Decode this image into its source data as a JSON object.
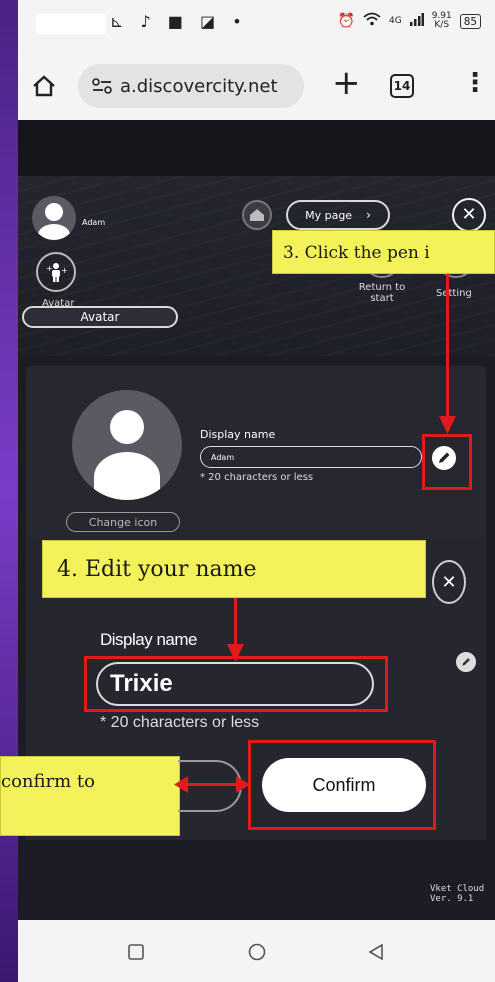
{
  "status_bar": {
    "left_icons": "⊾ ♪ ■ ◪ •",
    "network": "4G",
    "speed_value": "9.91",
    "speed_unit": "K/S",
    "battery": "85"
  },
  "browser": {
    "url": "a.discovercity.net",
    "tab_count": "14"
  },
  "hud": {
    "username": "Adam",
    "avatar_label": "Avatar",
    "mypage_label": "My page",
    "return_label_line1": "Return to",
    "return_label_line2": "start",
    "setting_label": "Setting",
    "avatar_tab": "Avatar"
  },
  "profile": {
    "display_name_label": "Display name",
    "display_name_value": "Adam",
    "char_hint": "* 20 characters or less",
    "change_icon_label": "Change icon"
  },
  "zoom": {
    "display_name_label": "Display name",
    "name_value": "Trixie",
    "char_hint": "* 20 characters or less",
    "confirm_label": "Confirm"
  },
  "annotations": {
    "step3": "3. Click the pen i",
    "step4": "4. Edit your name",
    "step5": "confirm to"
  },
  "footer": {
    "version_line1": "Vket Cloud",
    "version_line2": "Ver. 9.1"
  },
  "colors": {
    "highlight": "#f3f25a",
    "annotation_red": "#e01b1b",
    "app_dark": "#1c1d24",
    "slide_purple": "#5b2a9e"
  }
}
